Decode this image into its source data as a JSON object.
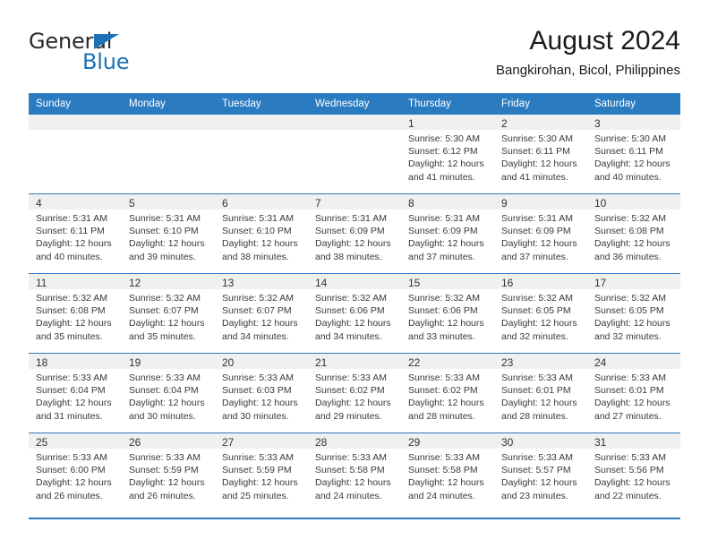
{
  "brand": {
    "name_part1": "General",
    "name_part2": "Blue",
    "logo_icon": "blue-triangle-icon",
    "accent_color": "#1b72b8"
  },
  "header": {
    "title": "August 2024",
    "subtitle": "Bangkirohan, Bicol, Philippines"
  },
  "theme": {
    "header_bar_color": "#2b7bc0",
    "daynum_band_color": "#f0f0f0",
    "text_color": "#3a3a3a"
  },
  "weekdays": [
    "Sunday",
    "Monday",
    "Tuesday",
    "Wednesday",
    "Thursday",
    "Friday",
    "Saturday"
  ],
  "weeks": [
    [
      {
        "day": "",
        "sunrise": "",
        "sunset": "",
        "daylight1": "",
        "daylight2": ""
      },
      {
        "day": "",
        "sunrise": "",
        "sunset": "",
        "daylight1": "",
        "daylight2": ""
      },
      {
        "day": "",
        "sunrise": "",
        "sunset": "",
        "daylight1": "",
        "daylight2": ""
      },
      {
        "day": "",
        "sunrise": "",
        "sunset": "",
        "daylight1": "",
        "daylight2": ""
      },
      {
        "day": "1",
        "sunrise": "Sunrise: 5:30 AM",
        "sunset": "Sunset: 6:12 PM",
        "daylight1": "Daylight: 12 hours",
        "daylight2": "and 41 minutes."
      },
      {
        "day": "2",
        "sunrise": "Sunrise: 5:30 AM",
        "sunset": "Sunset: 6:11 PM",
        "daylight1": "Daylight: 12 hours",
        "daylight2": "and 41 minutes."
      },
      {
        "day": "3",
        "sunrise": "Sunrise: 5:30 AM",
        "sunset": "Sunset: 6:11 PM",
        "daylight1": "Daylight: 12 hours",
        "daylight2": "and 40 minutes."
      }
    ],
    [
      {
        "day": "4",
        "sunrise": "Sunrise: 5:31 AM",
        "sunset": "Sunset: 6:11 PM",
        "daylight1": "Daylight: 12 hours",
        "daylight2": "and 40 minutes."
      },
      {
        "day": "5",
        "sunrise": "Sunrise: 5:31 AM",
        "sunset": "Sunset: 6:10 PM",
        "daylight1": "Daylight: 12 hours",
        "daylight2": "and 39 minutes."
      },
      {
        "day": "6",
        "sunrise": "Sunrise: 5:31 AM",
        "sunset": "Sunset: 6:10 PM",
        "daylight1": "Daylight: 12 hours",
        "daylight2": "and 38 minutes."
      },
      {
        "day": "7",
        "sunrise": "Sunrise: 5:31 AM",
        "sunset": "Sunset: 6:09 PM",
        "daylight1": "Daylight: 12 hours",
        "daylight2": "and 38 minutes."
      },
      {
        "day": "8",
        "sunrise": "Sunrise: 5:31 AM",
        "sunset": "Sunset: 6:09 PM",
        "daylight1": "Daylight: 12 hours",
        "daylight2": "and 37 minutes."
      },
      {
        "day": "9",
        "sunrise": "Sunrise: 5:31 AM",
        "sunset": "Sunset: 6:09 PM",
        "daylight1": "Daylight: 12 hours",
        "daylight2": "and 37 minutes."
      },
      {
        "day": "10",
        "sunrise": "Sunrise: 5:32 AM",
        "sunset": "Sunset: 6:08 PM",
        "daylight1": "Daylight: 12 hours",
        "daylight2": "and 36 minutes."
      }
    ],
    [
      {
        "day": "11",
        "sunrise": "Sunrise: 5:32 AM",
        "sunset": "Sunset: 6:08 PM",
        "daylight1": "Daylight: 12 hours",
        "daylight2": "and 35 minutes."
      },
      {
        "day": "12",
        "sunrise": "Sunrise: 5:32 AM",
        "sunset": "Sunset: 6:07 PM",
        "daylight1": "Daylight: 12 hours",
        "daylight2": "and 35 minutes."
      },
      {
        "day": "13",
        "sunrise": "Sunrise: 5:32 AM",
        "sunset": "Sunset: 6:07 PM",
        "daylight1": "Daylight: 12 hours",
        "daylight2": "and 34 minutes."
      },
      {
        "day": "14",
        "sunrise": "Sunrise: 5:32 AM",
        "sunset": "Sunset: 6:06 PM",
        "daylight1": "Daylight: 12 hours",
        "daylight2": "and 34 minutes."
      },
      {
        "day": "15",
        "sunrise": "Sunrise: 5:32 AM",
        "sunset": "Sunset: 6:06 PM",
        "daylight1": "Daylight: 12 hours",
        "daylight2": "and 33 minutes."
      },
      {
        "day": "16",
        "sunrise": "Sunrise: 5:32 AM",
        "sunset": "Sunset: 6:05 PM",
        "daylight1": "Daylight: 12 hours",
        "daylight2": "and 32 minutes."
      },
      {
        "day": "17",
        "sunrise": "Sunrise: 5:32 AM",
        "sunset": "Sunset: 6:05 PM",
        "daylight1": "Daylight: 12 hours",
        "daylight2": "and 32 minutes."
      }
    ],
    [
      {
        "day": "18",
        "sunrise": "Sunrise: 5:33 AM",
        "sunset": "Sunset: 6:04 PM",
        "daylight1": "Daylight: 12 hours",
        "daylight2": "and 31 minutes."
      },
      {
        "day": "19",
        "sunrise": "Sunrise: 5:33 AM",
        "sunset": "Sunset: 6:04 PM",
        "daylight1": "Daylight: 12 hours",
        "daylight2": "and 30 minutes."
      },
      {
        "day": "20",
        "sunrise": "Sunrise: 5:33 AM",
        "sunset": "Sunset: 6:03 PM",
        "daylight1": "Daylight: 12 hours",
        "daylight2": "and 30 minutes."
      },
      {
        "day": "21",
        "sunrise": "Sunrise: 5:33 AM",
        "sunset": "Sunset: 6:02 PM",
        "daylight1": "Daylight: 12 hours",
        "daylight2": "and 29 minutes."
      },
      {
        "day": "22",
        "sunrise": "Sunrise: 5:33 AM",
        "sunset": "Sunset: 6:02 PM",
        "daylight1": "Daylight: 12 hours",
        "daylight2": "and 28 minutes."
      },
      {
        "day": "23",
        "sunrise": "Sunrise: 5:33 AM",
        "sunset": "Sunset: 6:01 PM",
        "daylight1": "Daylight: 12 hours",
        "daylight2": "and 28 minutes."
      },
      {
        "day": "24",
        "sunrise": "Sunrise: 5:33 AM",
        "sunset": "Sunset: 6:01 PM",
        "daylight1": "Daylight: 12 hours",
        "daylight2": "and 27 minutes."
      }
    ],
    [
      {
        "day": "25",
        "sunrise": "Sunrise: 5:33 AM",
        "sunset": "Sunset: 6:00 PM",
        "daylight1": "Daylight: 12 hours",
        "daylight2": "and 26 minutes."
      },
      {
        "day": "26",
        "sunrise": "Sunrise: 5:33 AM",
        "sunset": "Sunset: 5:59 PM",
        "daylight1": "Daylight: 12 hours",
        "daylight2": "and 26 minutes."
      },
      {
        "day": "27",
        "sunrise": "Sunrise: 5:33 AM",
        "sunset": "Sunset: 5:59 PM",
        "daylight1": "Daylight: 12 hours",
        "daylight2": "and 25 minutes."
      },
      {
        "day": "28",
        "sunrise": "Sunrise: 5:33 AM",
        "sunset": "Sunset: 5:58 PM",
        "daylight1": "Daylight: 12 hours",
        "daylight2": "and 24 minutes."
      },
      {
        "day": "29",
        "sunrise": "Sunrise: 5:33 AM",
        "sunset": "Sunset: 5:58 PM",
        "daylight1": "Daylight: 12 hours",
        "daylight2": "and 24 minutes."
      },
      {
        "day": "30",
        "sunrise": "Sunrise: 5:33 AM",
        "sunset": "Sunset: 5:57 PM",
        "daylight1": "Daylight: 12 hours",
        "daylight2": "and 23 minutes."
      },
      {
        "day": "31",
        "sunrise": "Sunrise: 5:33 AM",
        "sunset": "Sunset: 5:56 PM",
        "daylight1": "Daylight: 12 hours",
        "daylight2": "and 22 minutes."
      }
    ]
  ]
}
